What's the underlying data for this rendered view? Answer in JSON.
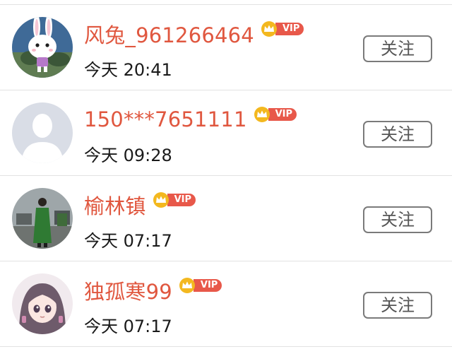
{
  "users": [
    {
      "name": "风兔_961266464",
      "vip": "VIP",
      "time": "今天 20:41",
      "follow": "关注",
      "avatar": "rabbit-avatar"
    },
    {
      "name": "150***7651111",
      "vip": "VIP",
      "time": "今天 09:28",
      "follow": "关注",
      "avatar": "default-user-avatar"
    },
    {
      "name": "榆林镇",
      "vip": "VIP",
      "time": "今天 07:17",
      "follow": "关注",
      "avatar": "person-photo-avatar"
    },
    {
      "name": "独孤寒99",
      "vip": "VIP",
      "time": "今天 07:17",
      "follow": "关注",
      "avatar": "anime-girl-avatar"
    }
  ],
  "colors": {
    "name": "#e0573f",
    "vip_badge": "#e8584a",
    "crown": "#f3b81f",
    "divider": "#e2e2e2",
    "button_border": "#7a7a7a"
  }
}
